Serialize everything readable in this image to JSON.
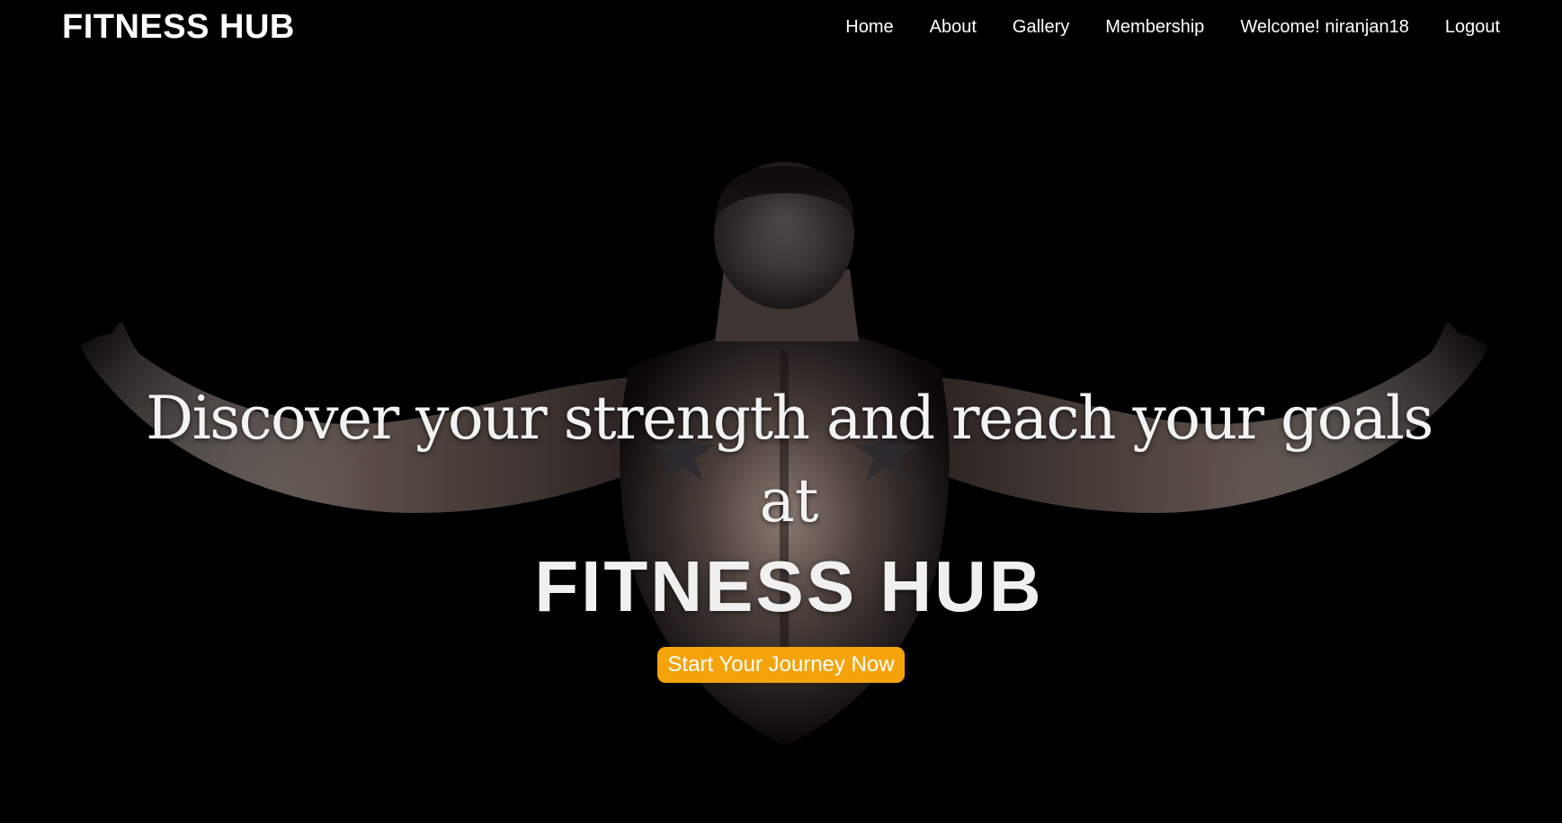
{
  "navbar": {
    "brand": "FITNESS HUB",
    "links": [
      {
        "label": "Home"
      },
      {
        "label": "About"
      },
      {
        "label": "Gallery"
      },
      {
        "label": "Membership"
      },
      {
        "label": "Welcome! niranjan18"
      },
      {
        "label": "Logout"
      }
    ]
  },
  "hero": {
    "tagline_line1": "Discover your strength and reach your goals",
    "tagline_line2": "at",
    "title": "FITNESS HUB",
    "cta_label": "Start Your Journey Now",
    "background_image": "muscular-back-silhouette",
    "cta_color": "#f5a30a",
    "background_color": "#000000"
  }
}
